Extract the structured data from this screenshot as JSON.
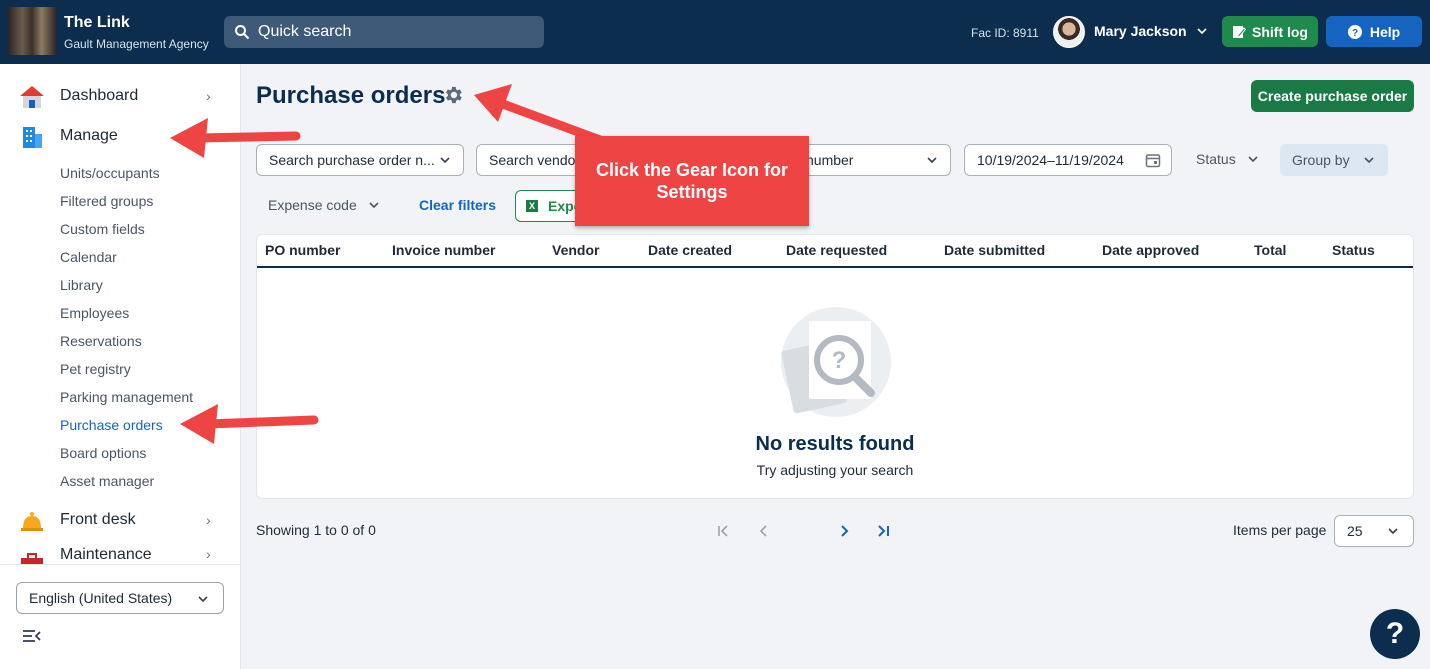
{
  "header": {
    "title": "The Link",
    "subtitle": "Gault Management Agency",
    "search_placeholder": "Quick search",
    "fac_id": "Fac ID: 8911",
    "user_name": "Mary Jackson",
    "shift_log_label": "Shift log",
    "help_label": "Help"
  },
  "sidebar": {
    "dashboard": "Dashboard",
    "manage": "Manage",
    "sub_items": [
      "Units/occupants",
      "Filtered groups",
      "Custom fields",
      "Calendar",
      "Library",
      "Employees",
      "Reservations",
      "Pet registry",
      "Parking management",
      "Purchase orders",
      "Board options",
      "Asset manager"
    ],
    "active_item": "Purchase orders",
    "front_desk": "Front desk",
    "maintenance": "Maintenance",
    "language": "English (United States)"
  },
  "main": {
    "title": "Purchase orders",
    "create_button": "Create purchase order",
    "filters": {
      "po_search": "Search purchase order n...",
      "vendor_search": "Search vendor",
      "invoice_search": "number",
      "date_range": "10/19/2024–11/19/2024",
      "status": "Status",
      "group_by": "Group by",
      "expense_code": "Expense code",
      "clear_filters": "Clear filters",
      "export": "Expo"
    },
    "columns": [
      "PO number",
      "Invoice number",
      "Vendor",
      "Date created",
      "Date requested",
      "Date submitted",
      "Date approved",
      "Total",
      "Status"
    ],
    "empty_title": "No results found",
    "empty_sub": "Try adjusting your search",
    "showing": "Showing 1 to 0 of 0",
    "items_per_page_label": "Items per page",
    "items_per_page": "25"
  },
  "callout": {
    "text": "Click the Gear Icon for Settings",
    "color": "#ef4444"
  },
  "colors": {
    "topbar": "#0c2d4e",
    "accent": "#1565c0",
    "green": "#1e8a4c"
  }
}
